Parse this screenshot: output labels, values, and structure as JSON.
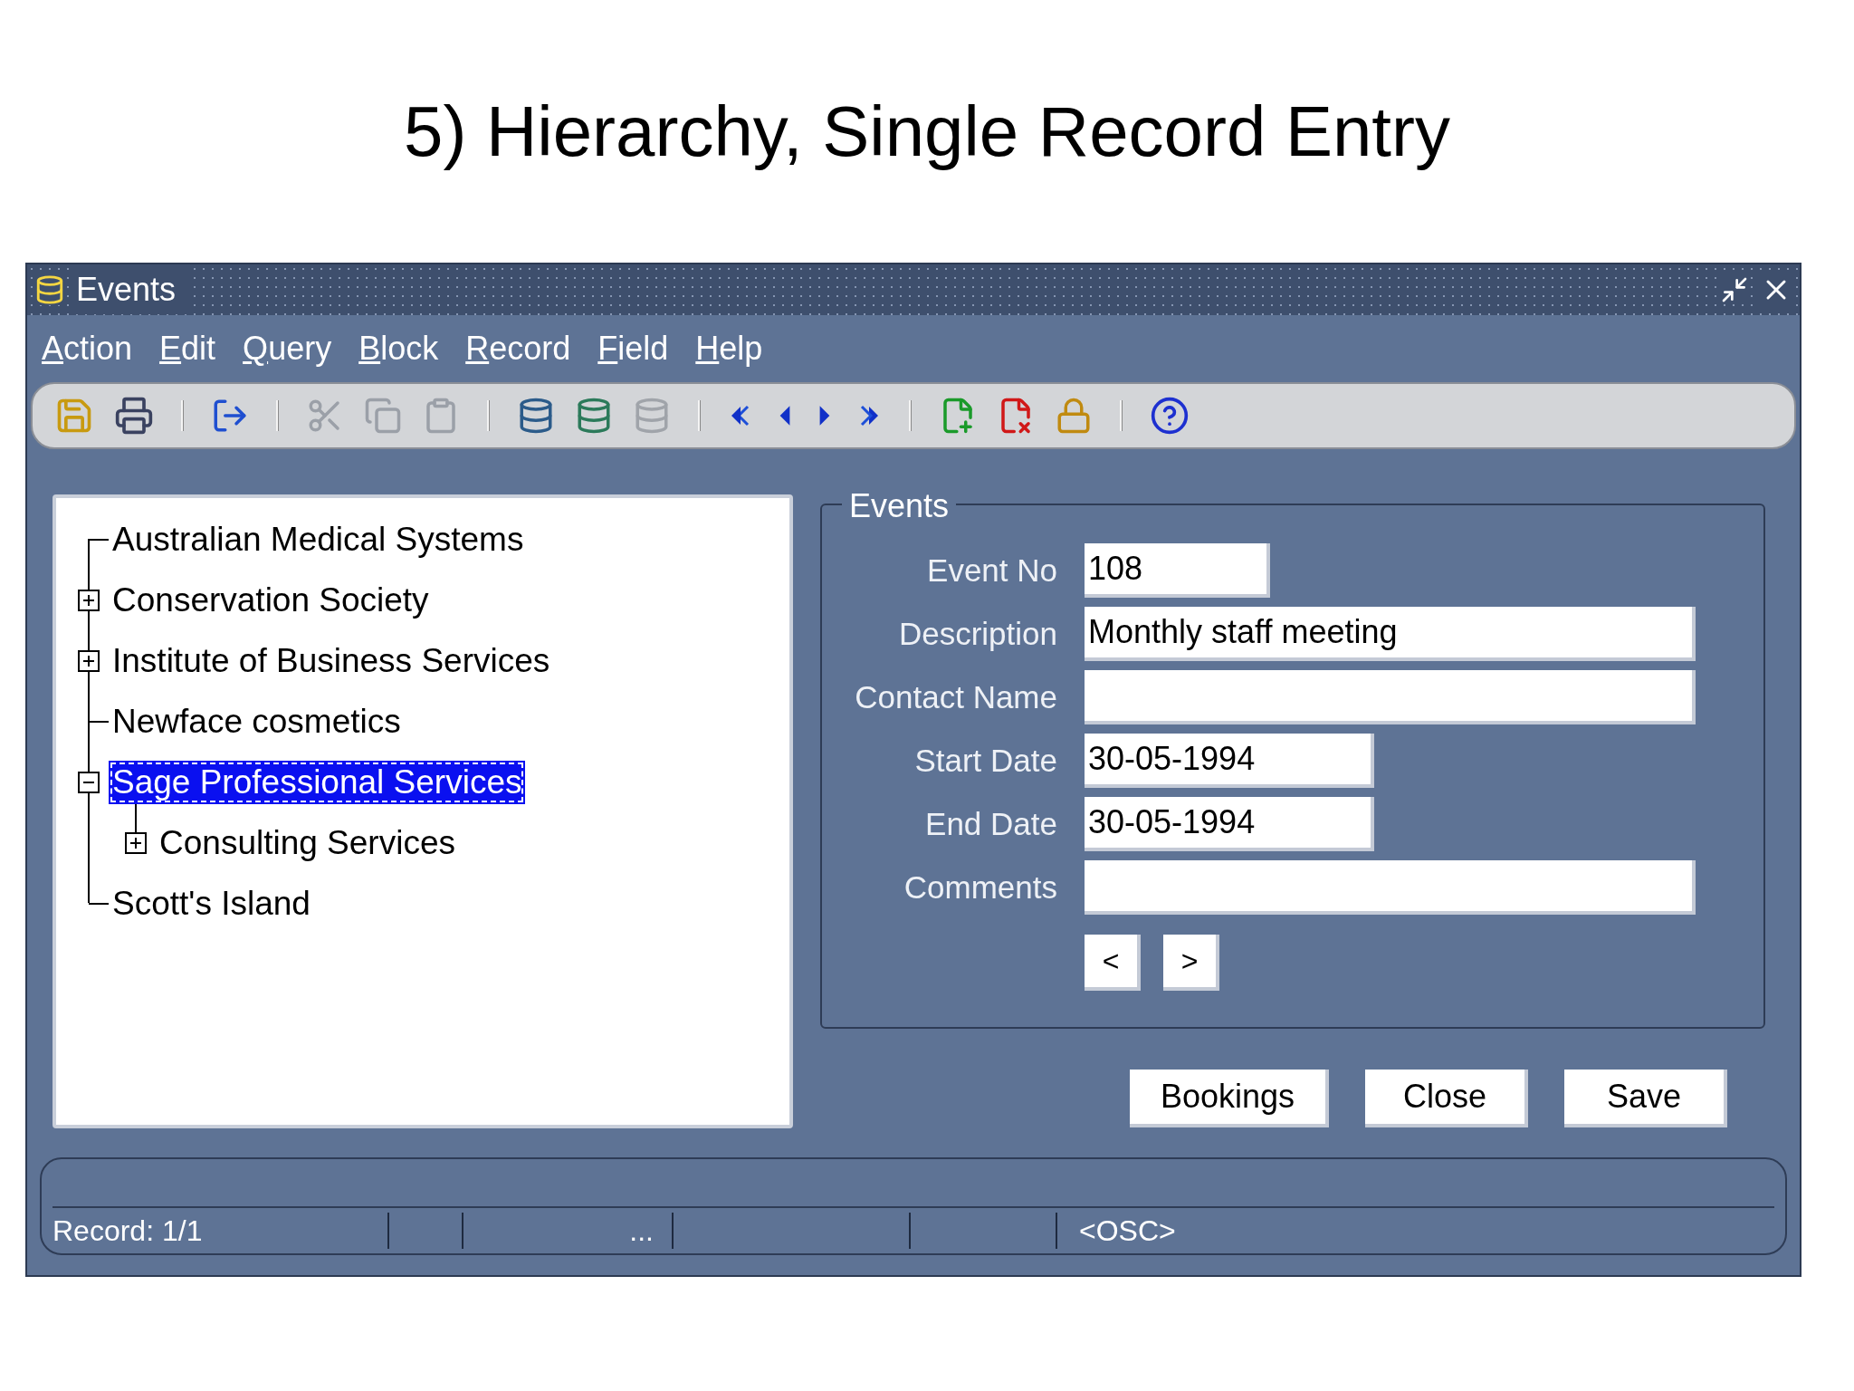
{
  "slide_title": "5) Hierarchy, Single Record Entry",
  "window": {
    "title": "Events"
  },
  "menu": [
    "Action",
    "Edit",
    "Query",
    "Block",
    "Record",
    "Field",
    "Help"
  ],
  "tree": [
    {
      "label": "Australian Medical Systems",
      "kind": "leaf",
      "selected": false
    },
    {
      "label": "Conservation Society",
      "kind": "branch",
      "expanded": false,
      "selected": false
    },
    {
      "label": "Institute of Business Services",
      "kind": "branch",
      "expanded": false,
      "selected": false
    },
    {
      "label": "Newface cosmetics",
      "kind": "leaf",
      "selected": false
    },
    {
      "label": "Sage Professional Services",
      "kind": "branch",
      "expanded": true,
      "selected": true,
      "children": [
        {
          "label": "Consulting Services",
          "kind": "branch",
          "expanded": false,
          "selected": false
        }
      ]
    },
    {
      "label": "Scott's Island",
      "kind": "leaf",
      "selected": false
    }
  ],
  "form": {
    "title": "Events",
    "fields": [
      {
        "label": "Event No",
        "kind": "short",
        "value": "108"
      },
      {
        "label": "Description",
        "kind": "long",
        "value": "Monthly staff meeting"
      },
      {
        "label": "Contact Name",
        "kind": "long"
      },
      {
        "label": "Start Date",
        "kind": "date",
        "value": "30-05-1994"
      },
      {
        "label": "End Date",
        "kind": "date",
        "value": "30-05-1994"
      },
      {
        "label": "Comments",
        "kind": "long"
      }
    ],
    "nav_buttons": [
      "<",
      ">"
    ]
  },
  "buttons": [
    "Bookings",
    "Close",
    "Save"
  ],
  "status_bar": {
    "record": "Record: 1/1",
    "ellipsis": "...",
    "mode": "<OSC>"
  }
}
